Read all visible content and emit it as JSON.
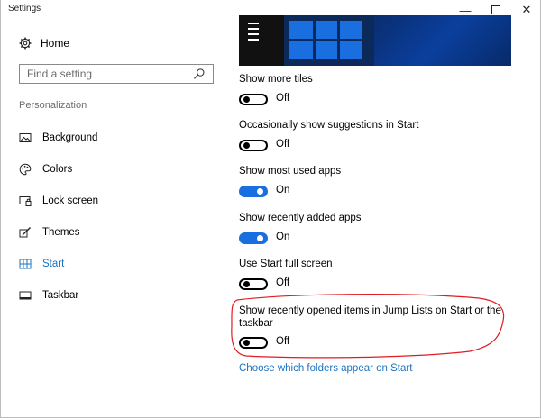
{
  "window": {
    "title": "Settings",
    "min_glyph": "—",
    "close_glyph": "✕"
  },
  "sidebar": {
    "home_label": "Home",
    "search_placeholder": "Find a setting",
    "section_label": "Personalization",
    "items": [
      {
        "label": "Background",
        "icon": "picture-icon"
      },
      {
        "label": "Colors",
        "icon": "palette-icon"
      },
      {
        "label": "Lock screen",
        "icon": "lock-screen-icon"
      },
      {
        "label": "Themes",
        "icon": "brush-icon"
      },
      {
        "label": "Start",
        "icon": "start-icon",
        "active": true
      },
      {
        "label": "Taskbar",
        "icon": "taskbar-icon"
      }
    ]
  },
  "settings": [
    {
      "label": "Show more tiles",
      "state": "Off"
    },
    {
      "label": "Occasionally show suggestions in Start",
      "state": "Off"
    },
    {
      "label": "Show most used apps",
      "state": "On"
    },
    {
      "label": "Show recently added apps",
      "state": "On"
    },
    {
      "label": "Use Start full screen",
      "state": "Off"
    },
    {
      "label": "Show recently opened items in Jump Lists on Start or the",
      "label2": "taskbar",
      "state": "Off"
    }
  ],
  "link": "Choose which folders appear on Start",
  "colors": {
    "accent": "#1a6fe0",
    "annotation": "#e01b24"
  }
}
